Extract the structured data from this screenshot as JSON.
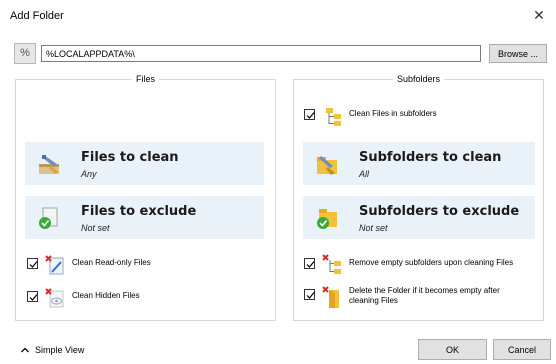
{
  "window": {
    "title": "Add Folder"
  },
  "path": {
    "prefix": "%",
    "value": "%LOCALAPPDATA%\\",
    "browse_label": "Browse ..."
  },
  "files": {
    "group_title": "Files",
    "to_clean": {
      "title": "Files to clean",
      "value": "Any"
    },
    "to_exclude": {
      "title": "Files to exclude",
      "value": "Not set"
    },
    "options": [
      {
        "label": "Clean Read-only Files",
        "checked": true
      },
      {
        "label": "Clean Hidden Files",
        "checked": true
      }
    ]
  },
  "subfolders": {
    "group_title": "Subfolders",
    "clean_in_subfolders": {
      "label": "Clean Files in subfolders",
      "checked": true
    },
    "to_clean": {
      "title": "Subfolders to clean",
      "value": "All"
    },
    "to_exclude": {
      "title": "Subfolders to exclude",
      "value": "Not set"
    },
    "options": [
      {
        "label": "Remove empty subfolders upon cleaning Files",
        "checked": true
      },
      {
        "label": "Delete the Folder if it becomes empty after cleaning Files",
        "checked": true
      }
    ]
  },
  "footer": {
    "simple_view_label": "Simple View",
    "ok_label": "OK",
    "cancel_label": "Cancel"
  },
  "colors": {
    "tile_bg": "#e9f1f9",
    "folder": "#f2c13b",
    "accent_blue": "#2a6fdb",
    "green": "#3aa83a",
    "red": "#d92b2b"
  }
}
